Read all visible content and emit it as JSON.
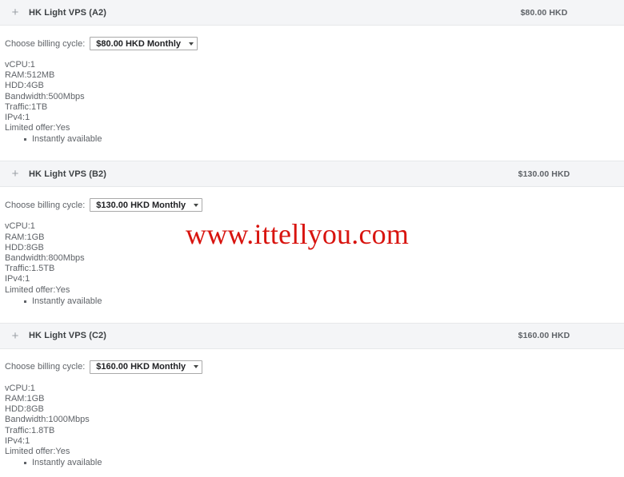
{
  "watermark": {
    "text": "www.ittellyou.com",
    "color": "#d8140f"
  },
  "icons": {
    "toggle": "+",
    "caret": "dropdown-caret"
  },
  "common": {
    "billing_label": "Choose billing cycle:"
  },
  "products": [
    {
      "title": "HK Light VPS (A2)",
      "price": "$80.00 HKD",
      "billing_label": "Choose billing cycle:",
      "billing_selected": "$80.00 HKD Monthly",
      "specs": [
        "vCPU:1",
        "RAM:512MB",
        "HDD:4GB",
        "Bandwidth:500Mbps",
        "Traffic:1TB",
        "IPv4:1",
        "Limited offer:Yes"
      ],
      "sub_items": [
        "Instantly available"
      ]
    },
    {
      "title": "HK Light VPS (B2)",
      "price": "$130.00 HKD",
      "billing_label": "Choose billing cycle:",
      "billing_selected": "$130.00 HKD Monthly",
      "specs": [
        "vCPU:1",
        "RAM:1GB",
        "HDD:8GB",
        "Bandwidth:800Mbps",
        "Traffic:1.5TB",
        "IPv4:1",
        "Limited offer:Yes"
      ],
      "sub_items": [
        "Instantly available"
      ]
    },
    {
      "title": "HK Light VPS (C2)",
      "price": "$160.00 HKD",
      "billing_label": "Choose billing cycle:",
      "billing_selected": "$160.00 HKD Monthly",
      "specs": [
        "vCPU:1",
        "RAM:1GB",
        "HDD:8GB",
        "Bandwidth:1000Mbps",
        "Traffic:1.8TB",
        "IPv4:1",
        "Limited offer:Yes"
      ],
      "sub_items": [
        "Instantly available"
      ]
    }
  ]
}
